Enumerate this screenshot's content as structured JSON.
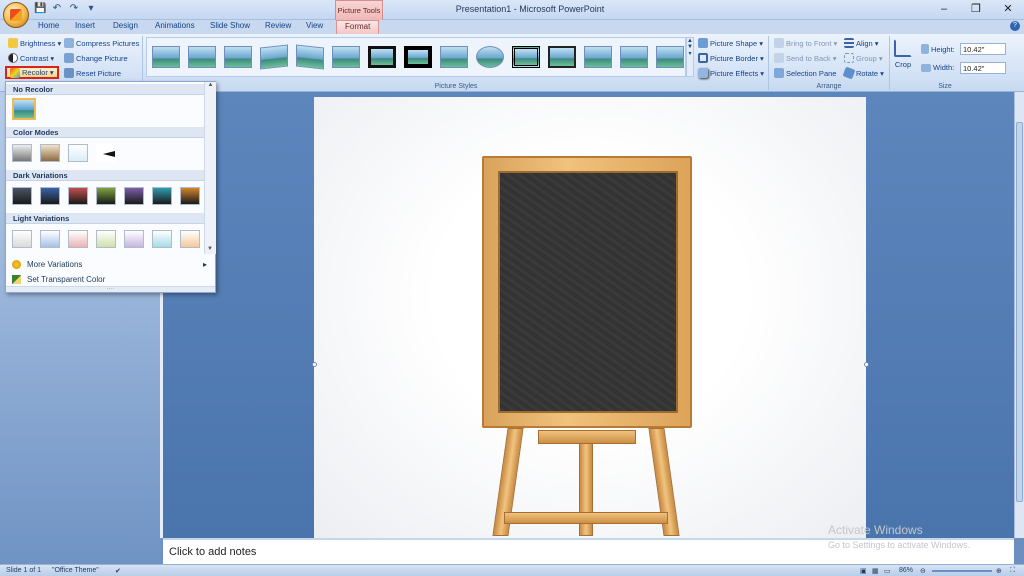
{
  "window": {
    "title": "Presentation1 - Microsoft PowerPoint",
    "context_tools": "Picture Tools",
    "min": "–",
    "max": "❐",
    "close": "✕"
  },
  "qat": {
    "save": "💾",
    "undo": "↶",
    "redo": "↷",
    "more": "▾"
  },
  "tabs": [
    "Home",
    "Insert",
    "Design",
    "Animations",
    "Slide Show",
    "Review",
    "View",
    "Format"
  ],
  "active_tab": "Format",
  "adjust": {
    "brightness": "Brightness ▾",
    "contrast": "Contrast ▾",
    "recolor": "Recolor ▾",
    "compress": "Compress Pictures",
    "change": "Change Picture",
    "reset": "Reset Picture"
  },
  "picture_styles": {
    "label": "Picture Styles",
    "shape": "Picture Shape ▾",
    "border": "Picture Border ▾",
    "effects": "Picture Effects ▾"
  },
  "arrange": {
    "label": "Arrange",
    "bring_front": "Bring to Front ▾",
    "send_back": "Send to Back ▾",
    "selection_pane": "Selection Pane",
    "align": "Align ▾",
    "group": "Group ▾",
    "rotate": "Rotate ▾"
  },
  "size": {
    "label": "Size",
    "crop": "Crop",
    "height_label": "Height:",
    "height_value": "10.42\"",
    "width_label": "Width:",
    "width_value": "10.42\""
  },
  "recolor_menu": {
    "no_recolor": "No Recolor",
    "color_modes": "Color Modes",
    "dark_variations": "Dark Variations",
    "light_variations": "Light Variations",
    "more_variations": "More Variations",
    "set_transparent": "Set Transparent Color",
    "dark_colors": [
      "#4a5566",
      "#3a63a8",
      "#c0504d",
      "#7da33f",
      "#7b5ea7",
      "#2f9bb0",
      "#d4832d"
    ],
    "light_colors": [
      "#d9d9d9",
      "#a8c0e6",
      "#eab3b2",
      "#cfe0a9",
      "#c6b6de",
      "#a7dbe6",
      "#f7c79a"
    ]
  },
  "notes": {
    "placeholder": "Click to add notes"
  },
  "watermark": {
    "line1": "Activate Windows",
    "line2": "Go to Settings to activate Windows."
  },
  "status": {
    "slide": "Slide 1 of 1",
    "theme": "\"Office Theme\"",
    "zoom": "86%"
  }
}
